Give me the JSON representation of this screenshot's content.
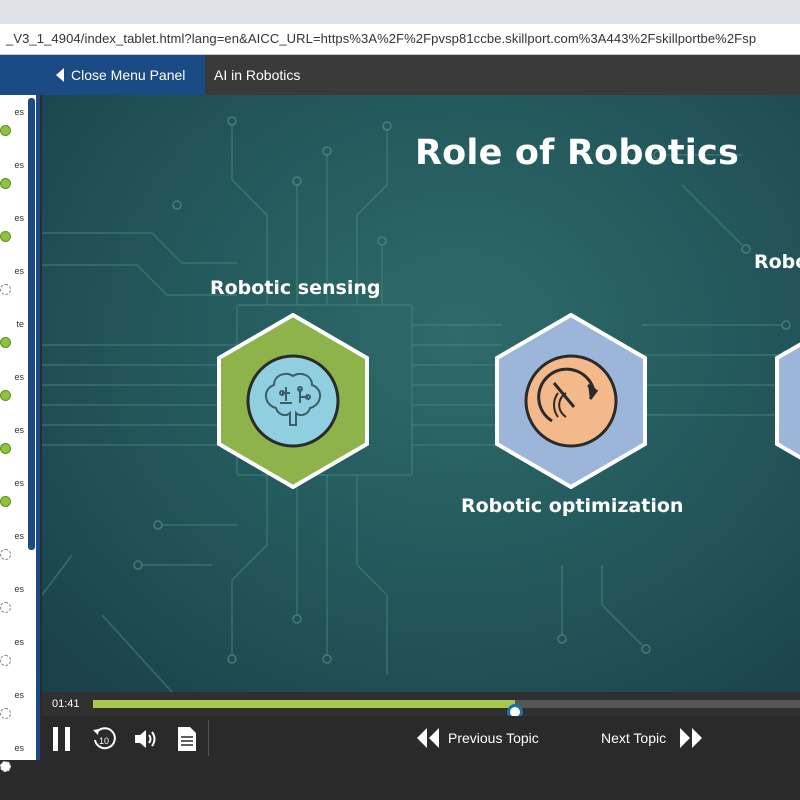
{
  "browser": {
    "url": "_V3_1_4904/index_tablet.html?lang=en&AICC_URL=https%3A%2F%2Fpvsp81ccbe.skillport.com%3A443%2Fskillportbe%2Fsp"
  },
  "header": {
    "close_menu_label": "Close Menu Panel",
    "course_title": "AI in Robotics"
  },
  "sidebar": {
    "items": [
      {
        "label": "es",
        "status": "complete"
      },
      {
        "label": "es",
        "status": "complete"
      },
      {
        "label": "es",
        "status": "complete"
      },
      {
        "label": "es",
        "status": "incomplete"
      },
      {
        "label": "te",
        "status": "complete"
      },
      {
        "label": "es",
        "status": "complete"
      },
      {
        "label": "es",
        "status": "complete"
      },
      {
        "label": "es",
        "status": "complete"
      },
      {
        "label": "es",
        "status": "incomplete"
      },
      {
        "label": "es",
        "status": "incomplete"
      },
      {
        "label": "es",
        "status": "incomplete"
      },
      {
        "label": "es",
        "status": "incomplete"
      },
      {
        "label": "es",
        "status": "incomplete"
      }
    ]
  },
  "slide": {
    "title": "Role of Robotics",
    "items": [
      {
        "label": "Robotic sensing",
        "icon": "brain-circuit-icon"
      },
      {
        "label": "Robotic optimization",
        "icon": "gauge-arrow-icon"
      },
      {
        "label": "Robo",
        "icon": "partial-hexagon"
      }
    ]
  },
  "player": {
    "current_time": "01:41",
    "progress_fraction": 0.597,
    "previous_label": "Previous Topic",
    "next_label": "Next Topic"
  },
  "colors": {
    "menu_blue": "#1b4b84",
    "progress_green": "#a7c84c",
    "hex_green": "#8db34a",
    "hex_blue": "#9bb6d9",
    "icon_orange": "#f4b98a",
    "icon_lightblue": "#8fcfe0"
  }
}
